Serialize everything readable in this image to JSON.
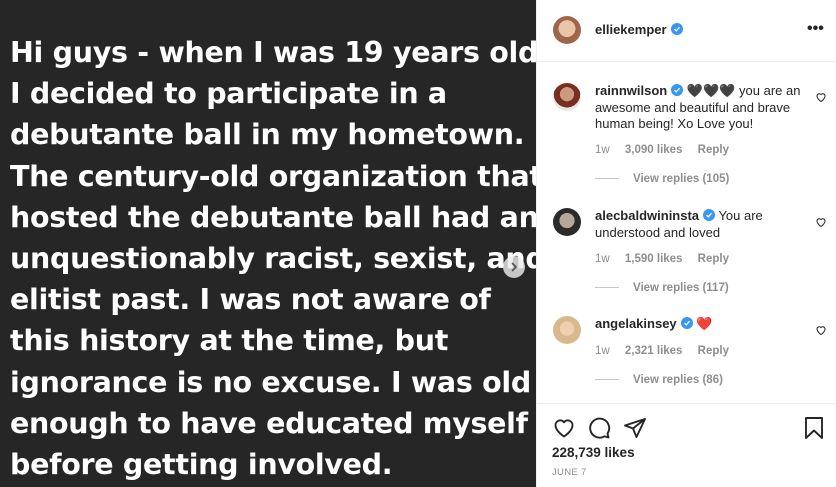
{
  "post": {
    "text_lines": [
      "Hi guys - when I was 19 years old,",
      "I decided to participate in a",
      "debutante ball in my hometown.",
      "The century-old organization that",
      "hosted the debutante ball had an",
      "unquestionably racist, sexist, and",
      "elitist past.  I was not aware of",
      "this history at the time, but",
      "ignorance is no excuse.  I was old",
      "enough to have educated myself",
      "before getting involved."
    ]
  },
  "header": {
    "username": "elliekemper",
    "more_label": "•••"
  },
  "comments": [
    {
      "username": "rainnwilson",
      "text": "🖤🖤🖤 you are an awesome and beautiful and brave human being! Xo Love you!",
      "time": "1w",
      "likes": "3,090 likes",
      "reply": "Reply",
      "view_replies": "View replies (105)"
    },
    {
      "username": "alecbaldwininsta",
      "text": "You are understood and loved",
      "time": "1w",
      "likes": "1,590 likes",
      "reply": "Reply",
      "view_replies": "View replies (117)"
    },
    {
      "username": "angelakinsey",
      "text": "❤️",
      "time": "1w",
      "likes": "2,321 likes",
      "reply": "Reply",
      "view_replies": "View replies (86)"
    }
  ],
  "footer": {
    "likes": "228,739 likes",
    "date": "JUNE 7"
  },
  "colors": {
    "post_bg": "#262626",
    "verified": "#3897f0",
    "muted": "#8e8e8e",
    "heart_red": "#ed4956"
  }
}
